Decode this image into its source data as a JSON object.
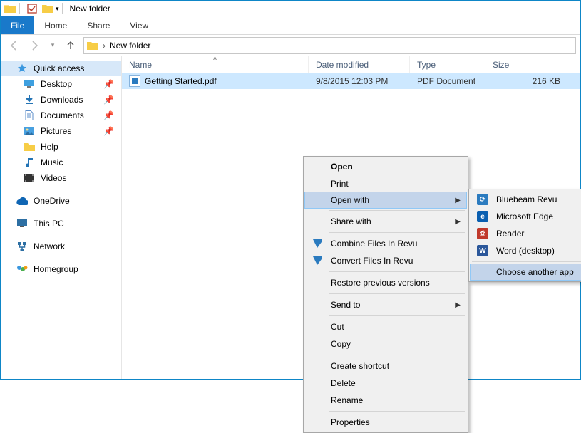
{
  "window": {
    "title": "New folder"
  },
  "menubar": {
    "file": "File",
    "home": "Home",
    "share": "Share",
    "view": "View"
  },
  "breadcrumb": {
    "current": "New folder"
  },
  "sidebar": {
    "quick_access": "Quick access",
    "items": [
      "Desktop",
      "Downloads",
      "Documents",
      "Pictures",
      "Help",
      "Music",
      "Videos"
    ],
    "onedrive": "OneDrive",
    "this_pc": "This PC",
    "network": "Network",
    "homegroup": "Homegroup"
  },
  "columns": {
    "name": "Name",
    "date": "Date modified",
    "type": "Type",
    "size": "Size"
  },
  "files": [
    {
      "name": "Getting Started.pdf",
      "date": "9/8/2015 12:03 PM",
      "type": "PDF Document",
      "size": "216 KB"
    }
  ],
  "context_menu": {
    "open": "Open",
    "print": "Print",
    "open_with": "Open with",
    "share_with": "Share with",
    "combine": "Combine Files In Revu",
    "convert": "Convert Files In Revu",
    "restore": "Restore previous versions",
    "send_to": "Send to",
    "cut": "Cut",
    "copy": "Copy",
    "shortcut": "Create shortcut",
    "delete": "Delete",
    "rename": "Rename",
    "properties": "Properties"
  },
  "open_with_menu": {
    "items": [
      "Bluebeam Revu",
      "Microsoft Edge",
      "Reader",
      "Word (desktop)"
    ],
    "choose": "Choose another app"
  }
}
